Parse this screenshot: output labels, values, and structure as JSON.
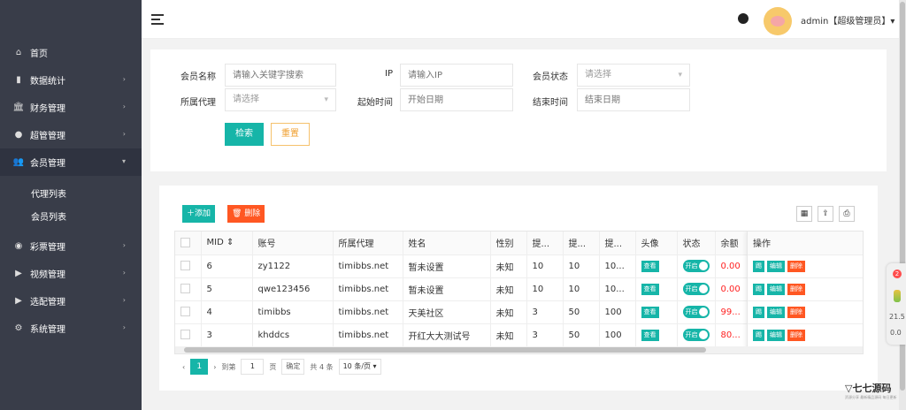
{
  "sidebar": {
    "items": [
      {
        "label": "首页",
        "icon": "home-icon",
        "glyph": "⌂"
      },
      {
        "label": "数据统计",
        "icon": "bar-chart-icon",
        "glyph": "▮"
      },
      {
        "label": "财务管理",
        "icon": "bank-icon",
        "glyph": "🏛"
      },
      {
        "label": "超管管理",
        "icon": "user-icon",
        "glyph": "●"
      },
      {
        "label": "会员管理",
        "icon": "users-icon",
        "glyph": "👥"
      }
    ],
    "sub_items": [
      "代理列表",
      "会员列表"
    ],
    "items_bottom": [
      {
        "label": "彩票管理",
        "icon": "gamepad-icon",
        "glyph": "◉"
      },
      {
        "label": "视频管理",
        "icon": "video-icon",
        "glyph": "▶"
      },
      {
        "label": "选配管理",
        "icon": "video2-icon",
        "glyph": "▶"
      },
      {
        "label": "系统管理",
        "icon": "gear-icon",
        "glyph": "⚙"
      }
    ]
  },
  "header": {
    "user": "admin【超级管理员】▾"
  },
  "search": {
    "member_name_label": "会员名称",
    "member_name_placeholder": "请输入关键字搜索",
    "ip_label": "IP",
    "ip_placeholder": "请输入IP",
    "status_label": "会员状态",
    "status_value": "请选择",
    "agent_label": "所属代理",
    "agent_value": "请选择",
    "start_label": "起始时间",
    "start_placeholder": "开始日期",
    "end_label": "结束时间",
    "end_placeholder": "结束日期",
    "search_btn": "检索",
    "reset_btn": "重置"
  },
  "toolbar": {
    "add": "＋添加",
    "delete": "🗑 删除"
  },
  "table": {
    "columns": [
      "MID ⇕",
      "账号",
      "所属代理",
      "姓名",
      "性别",
      "提...",
      "提...",
      "提...",
      "头像",
      "状态",
      "余额"
    ],
    "op_header": "操作",
    "view_btn": "查看",
    "switch_on": "开启",
    "op_buttons": [
      "踢",
      "编辑",
      "删除"
    ],
    "rows": [
      {
        "mid": "6",
        "account": "zy1122",
        "agent": "timibbs.net",
        "name": "暂未设置",
        "gender": "未知",
        "c1": "10",
        "c2": "10",
        "c3": "10...",
        "balance": "0.00"
      },
      {
        "mid": "5",
        "account": "qwe123456",
        "agent": "timibbs.net",
        "name": "暂未设置",
        "gender": "未知",
        "c1": "10",
        "c2": "10",
        "c3": "10...",
        "balance": "0.00"
      },
      {
        "mid": "4",
        "account": "timibbs",
        "agent": "timibbs.net",
        "name": "天美社区",
        "gender": "未知",
        "c1": "3",
        "c2": "50",
        "c3": "100",
        "balance": "99..."
      },
      {
        "mid": "3",
        "account": "khddcs",
        "agent": "timibbs.net",
        "name": "开红大大测试号",
        "gender": "未知",
        "c1": "3",
        "c2": "50",
        "c3": "100",
        "balance": "80..."
      }
    ]
  },
  "pager": {
    "prev": "‹",
    "current": "1",
    "next": "›",
    "goto": "到第",
    "page_input": "1",
    "page_unit": "页",
    "confirm": "确定",
    "total": "共 4 条",
    "page_size": "10 条/页 ▾"
  },
  "float_widget": {
    "badge": "2",
    "t1": "21.5",
    "t2": "0.0"
  },
  "watermark": "▽七七源码",
  "watermark_sub": "资源分享 最新精品源码 每日更新"
}
